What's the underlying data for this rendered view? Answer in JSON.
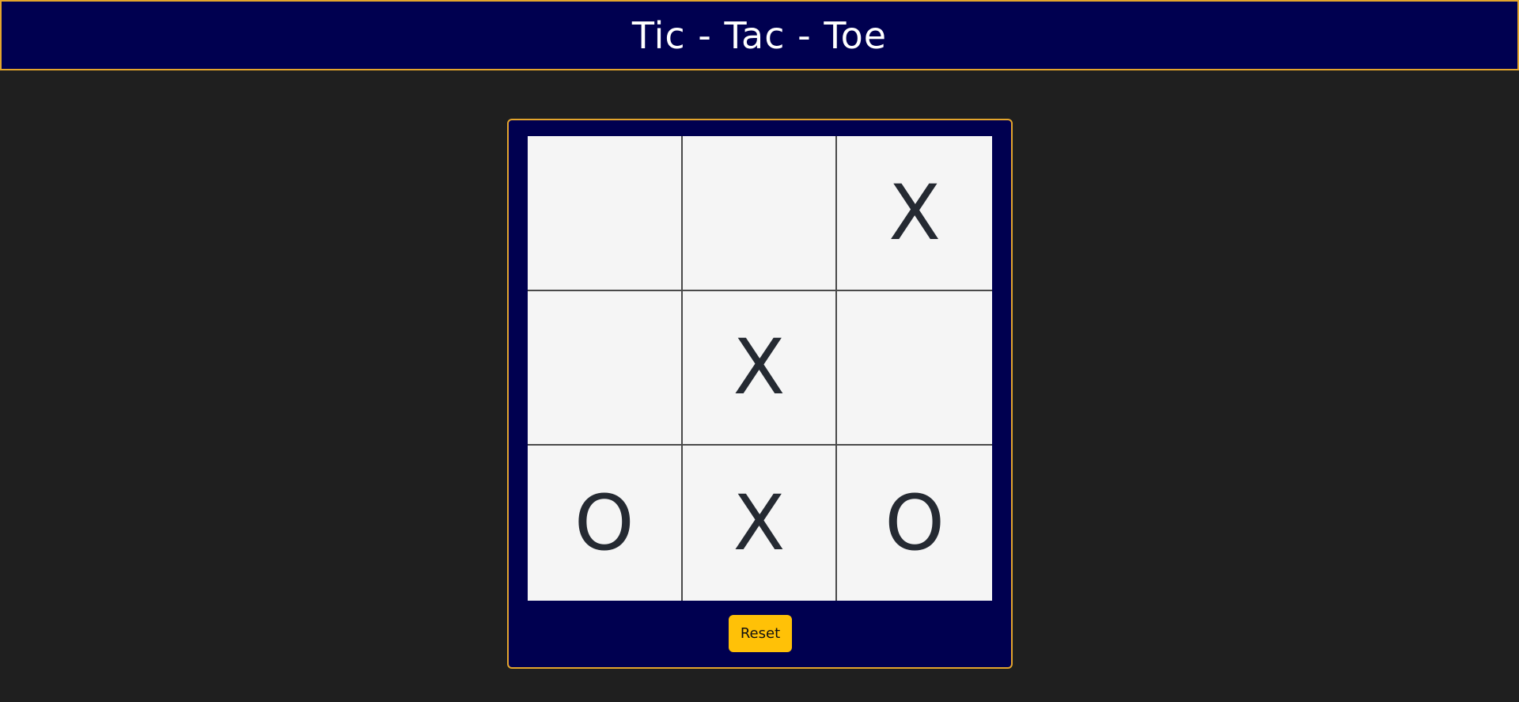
{
  "header": {
    "title": "Tic - Tac - Toe"
  },
  "board": {
    "cells": [
      [
        "",
        "",
        "X"
      ],
      [
        "",
        "X",
        ""
      ],
      [
        "O",
        "X",
        "O"
      ]
    ]
  },
  "controls": {
    "reset_label": "Reset"
  },
  "colors": {
    "page_background": "#1f1f1f",
    "header_background": "#000050",
    "border_accent": "#e3a52c",
    "cell_background": "#f5f5f5",
    "mark_color": "#252a32",
    "button_background": "#ffc107"
  }
}
